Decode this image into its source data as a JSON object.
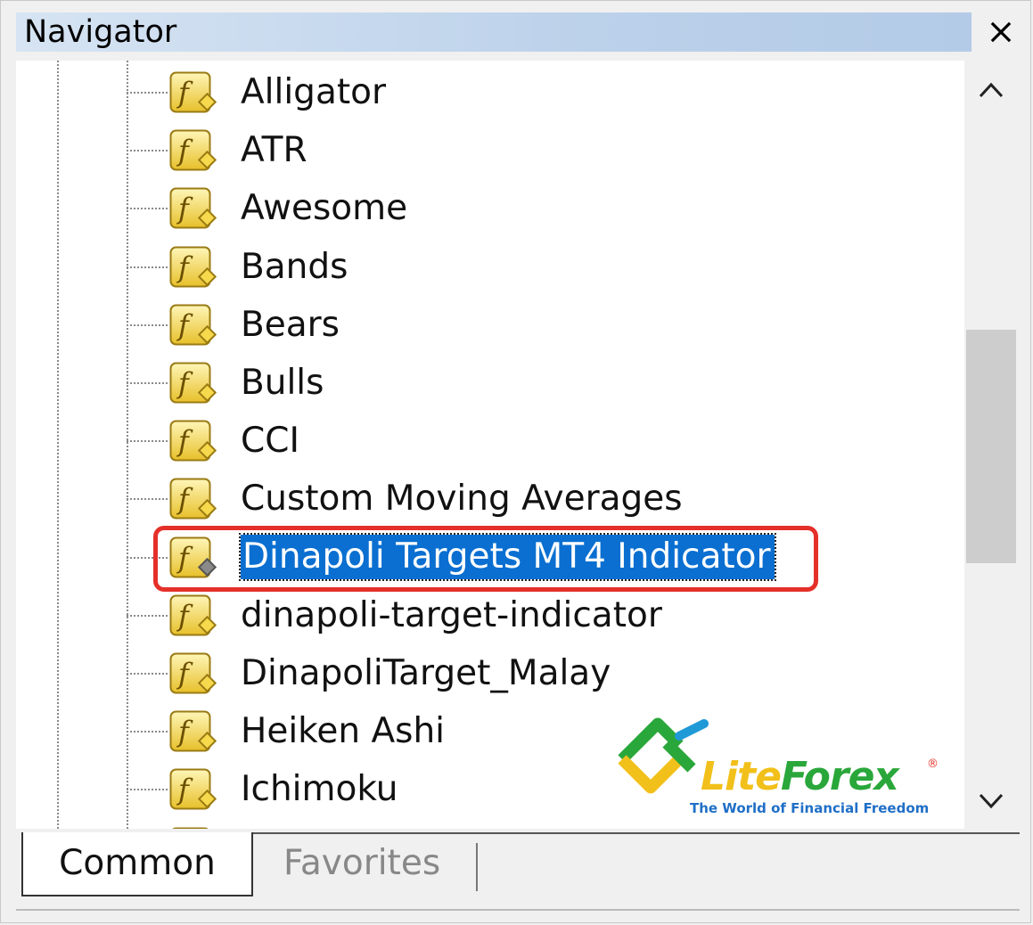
{
  "window": {
    "title": "Navigator",
    "close_symbol": "✕"
  },
  "tree": {
    "items": [
      {
        "label": "Alligator",
        "icon": "custom-indicator-icon"
      },
      {
        "label": "ATR",
        "icon": "custom-indicator-icon"
      },
      {
        "label": "Awesome",
        "icon": "custom-indicator-icon"
      },
      {
        "label": "Bands",
        "icon": "custom-indicator-icon"
      },
      {
        "label": "Bears",
        "icon": "custom-indicator-icon"
      },
      {
        "label": "Bulls",
        "icon": "custom-indicator-icon"
      },
      {
        "label": "CCI",
        "icon": "custom-indicator-icon"
      },
      {
        "label": "Custom Moving Averages",
        "icon": "custom-indicator-icon"
      },
      {
        "label": "Dinapoli Targets MT4 Indicator",
        "icon": "custom-indicator-icon",
        "selected": true,
        "highlighted": true
      },
      {
        "label": "dinapoli-target-indicator",
        "icon": "custom-indicator-icon"
      },
      {
        "label": "DinapoliTarget_Malay",
        "icon": "custom-indicator-icon"
      },
      {
        "label": "Heiken Ashi",
        "icon": "custom-indicator-icon"
      },
      {
        "label": "Ichimoku",
        "icon": "custom-indicator-icon"
      }
    ]
  },
  "watermark": {
    "brand_part1": "Lite",
    "brand_part2": "Forex",
    "registered": "®",
    "tagline": "The World of Financial Freedom"
  },
  "tabs": {
    "common": "Common",
    "favorites": "Favorites",
    "active": "Common"
  },
  "colors": {
    "selection": "#0a6fd1",
    "highlight_border": "#e5302a",
    "icon_fill": "#f6d94c",
    "brand_green": "#2aa73a",
    "brand_yellow": "#f2c01a",
    "brand_blue": "#1f6fc7"
  }
}
